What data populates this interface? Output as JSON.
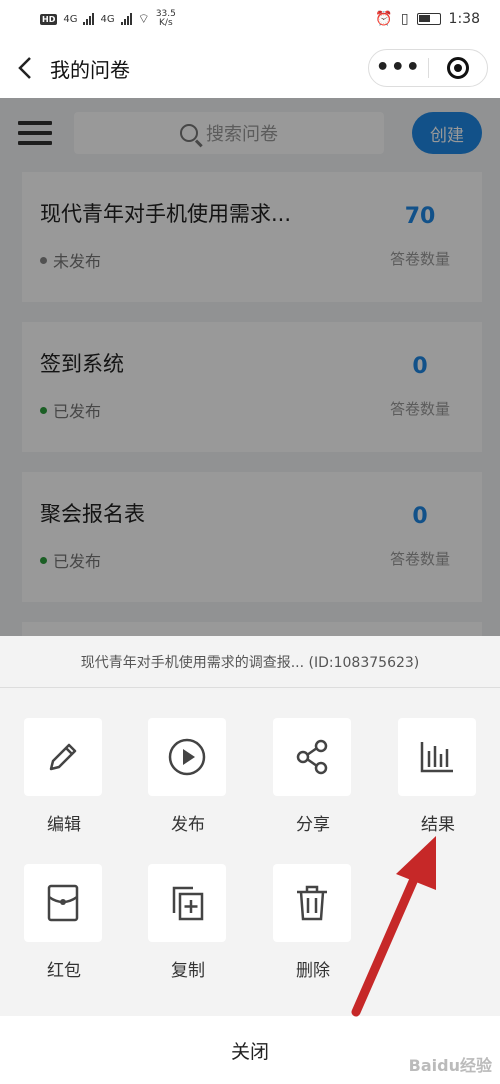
{
  "status_bar": {
    "hd": "HD",
    "net1": "4G",
    "net2": "4G",
    "speed": "33.5",
    "speed_unit": "K/s",
    "time": "1:38"
  },
  "title_bar": {
    "title": "我的问卷",
    "more_glyph": "•••"
  },
  "toolbar": {
    "search_placeholder": "搜索问卷",
    "create_label": "创建"
  },
  "surveys": [
    {
      "title": "现代青年对手机使用需求...",
      "status": "未发布",
      "status_color": "#888888",
      "count": "70",
      "count_label": "答卷数量"
    },
    {
      "title": "签到系统",
      "status": "已发布",
      "status_color": "#2e9e3e",
      "count": "0",
      "count_label": "答卷数量"
    },
    {
      "title": "聚会报名表",
      "status": "已发布",
      "status_color": "#2e9e3e",
      "count": "0",
      "count_label": "答卷数量"
    }
  ],
  "sheet": {
    "header": "现代青年对手机使用需求的调查报... (ID:108375623)",
    "actions": [
      {
        "label": "编辑",
        "icon": "pencil-icon"
      },
      {
        "label": "发布",
        "icon": "play-icon"
      },
      {
        "label": "分享",
        "icon": "share-icon"
      },
      {
        "label": "结果",
        "icon": "bar-chart-icon"
      },
      {
        "label": "红包",
        "icon": "red-envelope-icon"
      },
      {
        "label": "复制",
        "icon": "copy-icon"
      },
      {
        "label": "删除",
        "icon": "trash-icon"
      }
    ],
    "close_label": "关闭"
  },
  "colors": {
    "accent": "#1e88e5",
    "published": "#2e9e3e",
    "annotation_arrow": "#c62828"
  },
  "watermark": "Baidu经验"
}
